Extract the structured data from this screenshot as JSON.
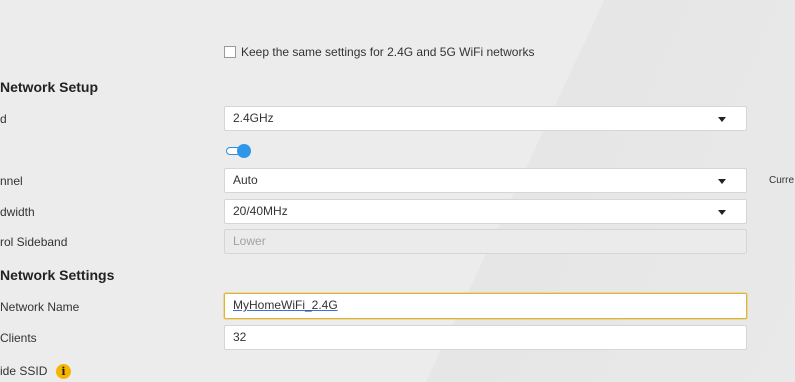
{
  "sync": {
    "checkbox_label": "Keep the same settings for 2.4G and 5G WiFi networks",
    "checked": false
  },
  "sections": {
    "network_setup": "Network Setup",
    "network_settings": "Network Settings"
  },
  "fields": {
    "band": {
      "label": "d",
      "value": "2.4GHz"
    },
    "wifi_toggle": {
      "state": "on"
    },
    "channel": {
      "label": "nnel",
      "value": "Auto",
      "side_text": "Curre"
    },
    "bandwidth": {
      "label": "dwidth",
      "value": "20/40MHz"
    },
    "control_sideband": {
      "label": "rol Sideband",
      "value": "Lower"
    },
    "network_name": {
      "label": "Network Name",
      "value": "MyHomeWiFi_2.4G"
    },
    "max_clients": {
      "label": "Clients",
      "value": "32"
    },
    "hide_ssid": {
      "label": "ide SSID",
      "info_icon": "i"
    }
  },
  "colors": {
    "accent": "#2f97ea",
    "focus": "#e2b431",
    "info": "#f6b600"
  }
}
